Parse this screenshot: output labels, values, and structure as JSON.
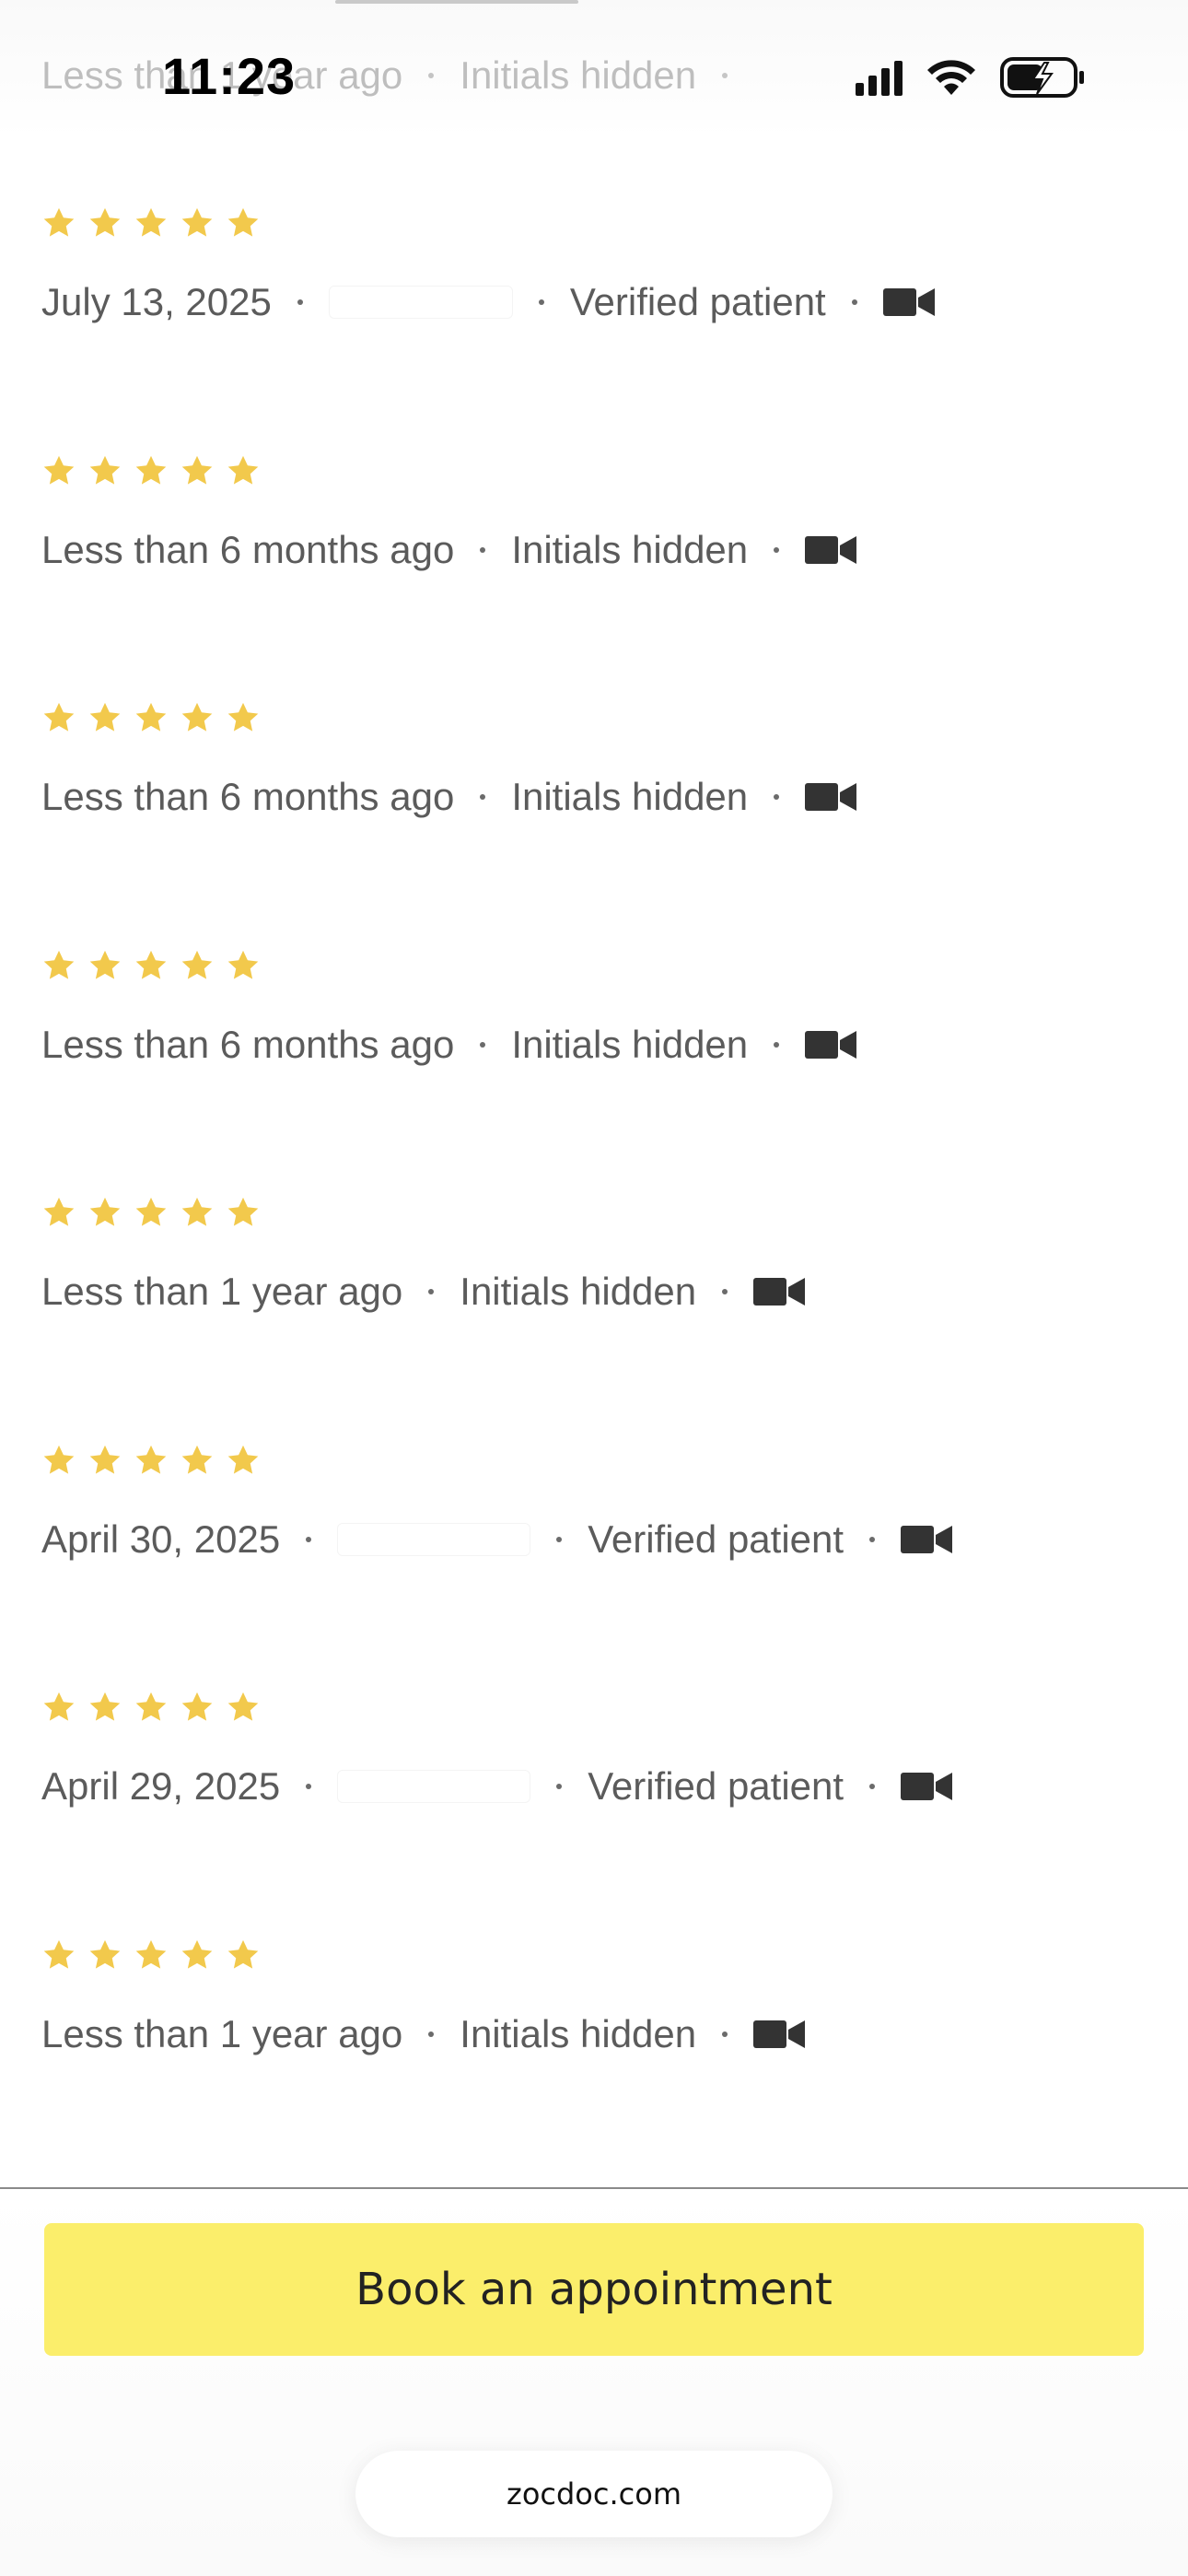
{
  "status_bar": {
    "time": "11:23"
  },
  "ghost_row": {
    "date": "Less than 1 year ago",
    "author": "Initials hidden"
  },
  "reviews": [
    {
      "rating": 5,
      "date": "July 13, 2025",
      "author_redacted": true,
      "verified": "Verified patient",
      "visit_type": "video-visit-icon"
    },
    {
      "rating": 5,
      "date": "Less than 6 months ago",
      "author": "Initials hidden",
      "visit_type": "video-visit-icon"
    },
    {
      "rating": 5,
      "date": "Less than 6 months ago",
      "author": "Initials hidden",
      "visit_type": "video-visit-icon"
    },
    {
      "rating": 5,
      "date": "Less than 6 months ago",
      "author": "Initials hidden",
      "visit_type": "video-visit-icon"
    },
    {
      "rating": 5,
      "date": "Less than 1 year ago",
      "author": "Initials hidden",
      "visit_type": "video-visit-icon"
    },
    {
      "rating": 5,
      "date": "April 30, 2025",
      "author_redacted": true,
      "verified": "Verified patient",
      "visit_type": "video-visit-icon"
    },
    {
      "rating": 5,
      "date": "April 29, 2025",
      "author_redacted": true,
      "verified": "Verified patient",
      "visit_type": "video-visit-icon"
    },
    {
      "rating": 5,
      "date": "Less than 1 year ago",
      "author": "Initials hidden",
      "visit_type": "video-visit-icon"
    }
  ],
  "cta": {
    "book_label": "Book an appointment"
  },
  "browser": {
    "url": "zocdoc.com"
  },
  "colors": {
    "star": "#f2c94c",
    "cta_background": "#fbee6b",
    "meta_text": "#5b5b5b",
    "icon": "#333333"
  }
}
